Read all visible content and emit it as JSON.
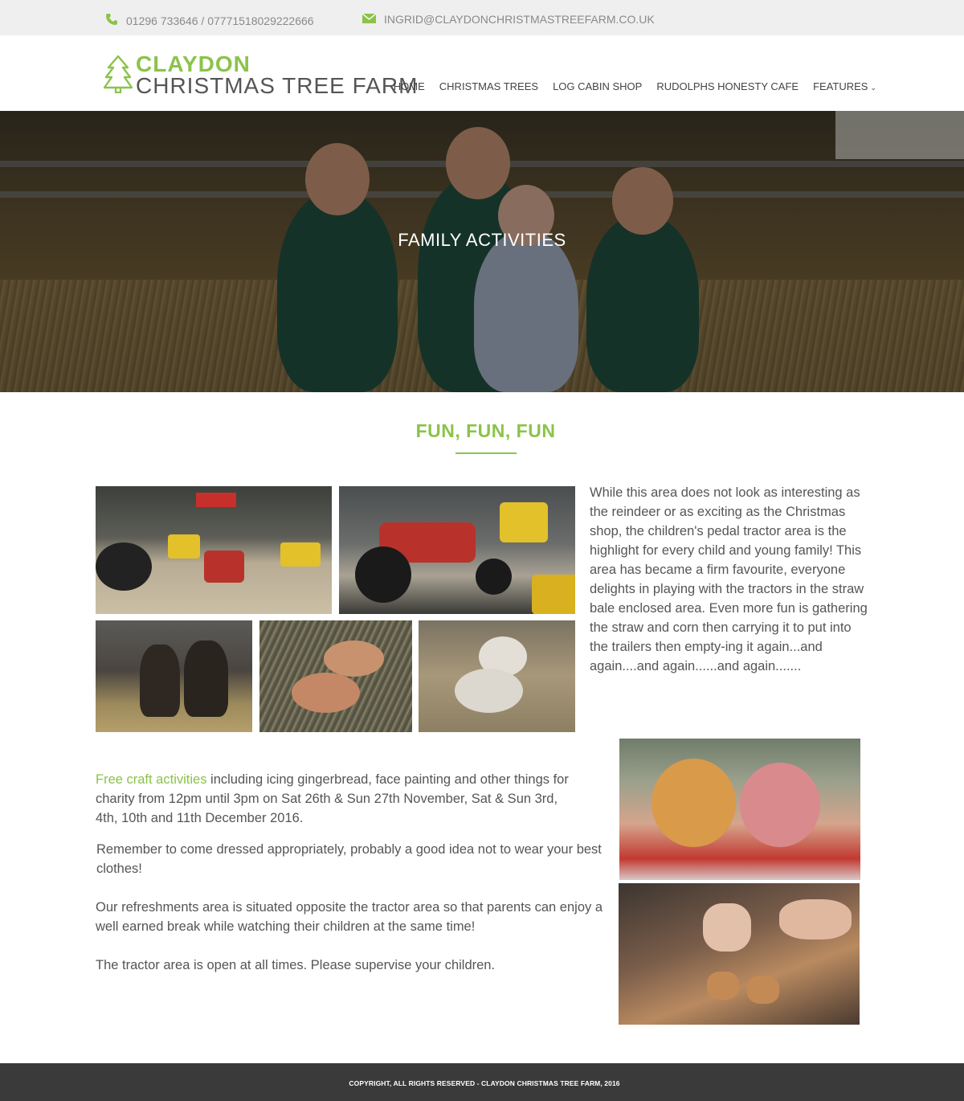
{
  "topbar": {
    "phone": "01296 733646 / 07771518029222666",
    "email": "INGRID@CLAYDONCHRISTMASTREEFARM.CO.UK"
  },
  "logo": {
    "line1": "CLAYDON",
    "line2": "CHRISTMAS TREE FARM"
  },
  "nav": {
    "items": [
      "HOME",
      "CHRISTMAS TREES",
      "LOG CABIN SHOP",
      "RUDOLPHS HONESTY CAFE",
      "FEATURES"
    ]
  },
  "hero": {
    "title": "FAMILY ACTIVITIES"
  },
  "section": {
    "title": "FUN, FUN, FUN"
  },
  "content": {
    "intro": "While this area does not look as interesting as the reindeer or as exciting as the Christmas shop, the children's pedal tractor area is the highlight for every child and young family! This  area has became a firm favourite, everyone delights in  playing with the tractors in the straw bale enclosed area.  Even more fun is gathering the straw and corn then carrying it to put into the trailers then empty-ing it again...and again....and again......and again.......",
    "craft_highlight": "Free craft activities",
    "craft_rest": " including icing gingerbread, face painting and other things for charity from 12pm until 3pm on Sat 26th & Sun 27th November, Sat & Sun 3rd, 4th, 10th and 11th December 2016.",
    "dress": "Remember to come dressed appropriately, probably a good idea not to wear your best clothes!",
    "refreshments": "Our refreshments area is situated opposite the tractor area so that parents can enjoy a well earned break while watching their children at the same time!",
    "open": "The tractor area is open at all times.  Please supervise your children."
  },
  "footer": {
    "copyright": "COPYRIGHT, ALL RIGHTS RESERVED - CLAYDON CHRISTMAS TREE FARM, 2016"
  },
  "colors": {
    "accent": "#8bc34a",
    "footer_bg": "#3a3a3a",
    "topbar_bg": "#efefef"
  }
}
